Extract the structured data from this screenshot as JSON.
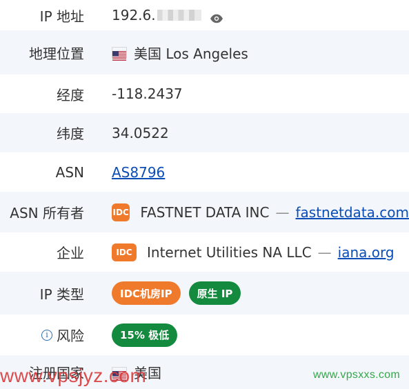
{
  "rows": {
    "ip": {
      "label": "IP 地址",
      "value_prefix": "192.6.",
      "masked": true,
      "eye_icon": "eye-icon"
    },
    "geo": {
      "label": "地理位置",
      "flag_icon": "us-flag-icon",
      "value": "美国 Los Angeles"
    },
    "longitude": {
      "label": "经度",
      "value": "-118.2437"
    },
    "latitude": {
      "label": "纬度",
      "value": "34.0522"
    },
    "asn": {
      "label": "ASN",
      "value": "AS8796"
    },
    "asn_owner": {
      "label": "ASN 所有者",
      "badge": "IDC",
      "name": "FASTNET DATA INC",
      "separator": "—",
      "domain": "fastnetdata.com"
    },
    "enterprise": {
      "label": "企业",
      "badge": "IDC",
      "name": "Internet Utilities NA LLC",
      "separator": "—",
      "domain": "iana.org"
    },
    "ip_type": {
      "label": "IP 类型",
      "tags": [
        "IDC机房IP",
        "原生 IP"
      ]
    },
    "risk": {
      "label": "风险",
      "info_icon": "info-icon",
      "value": "15% 极低"
    },
    "reg_country": {
      "label": "注册国家",
      "flag_icon": "us-flag-icon",
      "value": "美国"
    }
  },
  "watermarks": {
    "left": "www.vpsjyz.com",
    "right": "www.vpsxxs.com"
  },
  "colors": {
    "row_shade": "#f3f6fa",
    "link": "#0b4db6",
    "badge_orange": "#f07a2c",
    "badge_green": "#138a3d",
    "watermark_left": "#d93a3a",
    "watermark_right": "#37a64d"
  }
}
